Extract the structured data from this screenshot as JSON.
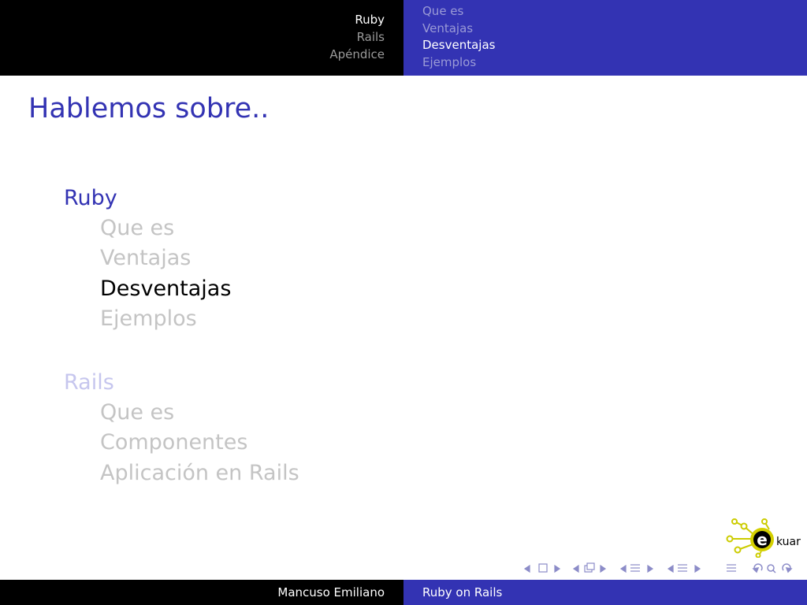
{
  "header": {
    "sections": [
      {
        "label": "Ruby",
        "color": "#ffffff"
      },
      {
        "label": "Rails",
        "color": "#9a9a9a"
      },
      {
        "label": "Apéndice",
        "color": "#9a9a9a"
      }
    ],
    "subsections": [
      {
        "label": "Que es",
        "color": "#9a9ad6"
      },
      {
        "label": "Ventajas",
        "color": "#9a9ad6"
      },
      {
        "label": "Desventajas",
        "color": "#ffffff"
      },
      {
        "label": "Ejemplos",
        "color": "#9a9ad6"
      }
    ]
  },
  "frame": {
    "title": "Hablemos sobre.."
  },
  "toc": [
    {
      "label": "Ruby",
      "color": "#3333b3",
      "items": [
        {
          "label": "Que es",
          "color": "#c4c4c4"
        },
        {
          "label": "Ventajas",
          "color": "#c4c4c4"
        },
        {
          "label": "Desventajas",
          "color": "#000000"
        },
        {
          "label": "Ejemplos",
          "color": "#c4c4c4"
        }
      ]
    },
    {
      "label": "Rails",
      "color": "#c6c6ee",
      "items": [
        {
          "label": "Que es",
          "color": "#c4c4c4"
        },
        {
          "label": "Componentes",
          "color": "#c4c4c4"
        },
        {
          "label": "Aplicación en Rails",
          "color": "#c4c4c4"
        }
      ]
    }
  ],
  "logo": {
    "text": "kuar",
    "letter": "e",
    "accent": "#d4d000"
  },
  "footer": {
    "author": "Mancuso Emiliano",
    "talk": "Ruby on Rails"
  },
  "colors": {
    "header_left_bg": "#000000",
    "header_right_bg": "#3333b3",
    "title": "#3333b3",
    "nav_icons": "#8c8cc8"
  }
}
